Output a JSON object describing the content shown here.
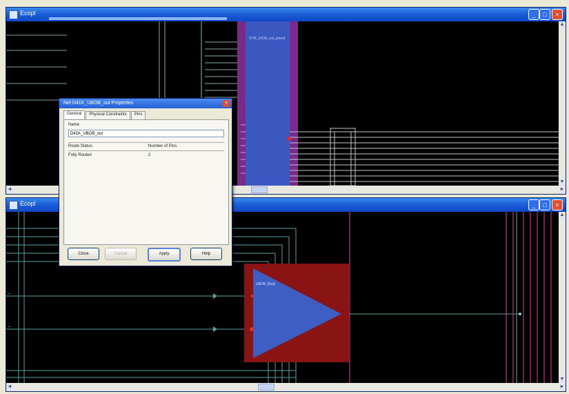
{
  "windows": [
    {
      "title": "Ecopl",
      "minimize_glyph": "_",
      "maximize_glyph": "□",
      "close_glyph": "×"
    },
    {
      "title": "Ecopl",
      "minimize_glyph": "_",
      "maximize_glyph": "□",
      "close_glyph": "×"
    }
  ],
  "top_canvas": {
    "block_label": "STIK_DIOD_out_joined"
  },
  "bottom_canvas": {
    "amp_label": "UBOB_Body",
    "left_net_label_1": "—",
    "left_net_label_2": "—"
  },
  "dialog": {
    "title": "Net D41K_UBOB_out Properties",
    "close_glyph": "×",
    "tabs": [
      "General",
      "Physical Constraints",
      "Pins"
    ],
    "active_tab": "General",
    "name_label": "Name",
    "name_value": "D41K_UBOB_out",
    "route_status_label": "Route Status",
    "route_status_value": "Fully Routed",
    "num_pins_label": "Number of Pins",
    "num_pins_value": "2",
    "buttons": {
      "close": "Close",
      "cancel": "Cancel",
      "apply": "Apply",
      "help": "Help"
    }
  },
  "scroll": {
    "left": "◄",
    "right": "►",
    "up": "▲",
    "down": "▼"
  },
  "colors": {
    "title_blue": "#1c5fd6",
    "block_blue": "#3a58c0",
    "block_border_purple": "#7a2a8a",
    "amp_blue": "#3d5fc4",
    "amp_bg_red": "#8a1414",
    "net_teal": "#5f9fa0",
    "pin_red": "#e0302a",
    "wire_pink": "#e040a0"
  }
}
